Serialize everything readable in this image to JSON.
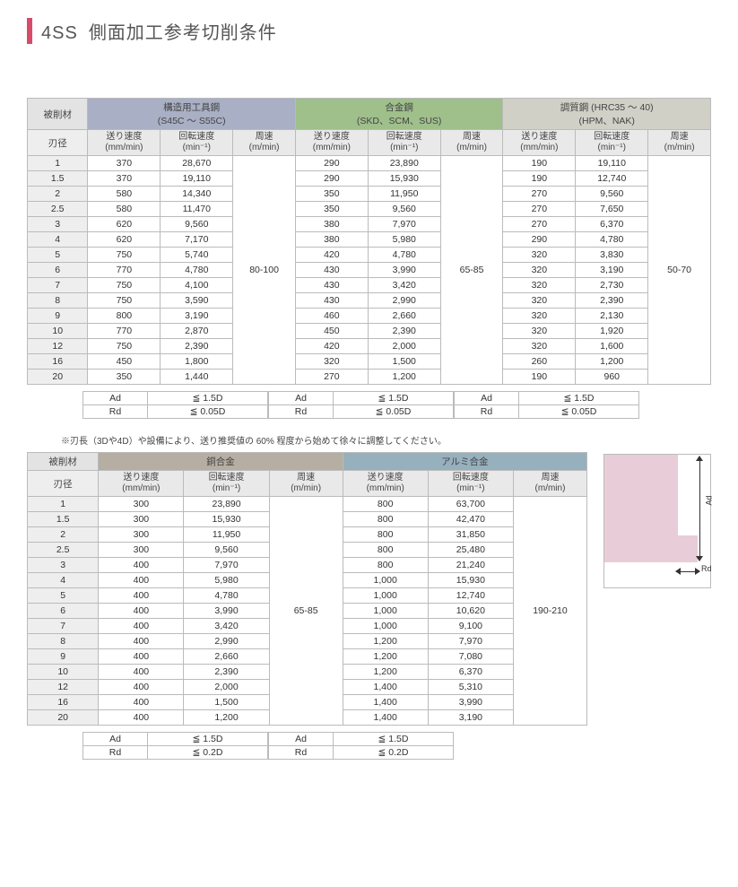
{
  "title_code": "4SS",
  "title_text": "側面加工参考切削条件",
  "labels": {
    "workpiece": "被削材",
    "diameter": "刃径",
    "feed": "送り速度",
    "feed_unit": "(mm/min)",
    "rpm": "回転速度",
    "rpm_unit": "(min⁻¹)",
    "surface": "周速",
    "surface_unit": "(m/min)",
    "ad": "Ad",
    "rd": "Rd"
  },
  "note": "※刃長（3Dや4D）や設備により、送り推奨値の 60% 程度から始めて徐々に調整してください。",
  "materials_top": [
    {
      "name_line1": "構造用工具鋼",
      "name_line2": "(S45C ～ S55C)",
      "cls": "hdr-m0"
    },
    {
      "name_line1": "合金鋼",
      "name_line2": "(SKD、SCM、SUS)",
      "cls": "hdr-m1"
    },
    {
      "name_line1": "調質鋼 (HRC35 ～ 40)",
      "name_line2": "(HPM、NAK)",
      "cls": "hdr-m2"
    }
  ],
  "materials_bottom": [
    {
      "name_line1": "銅合金",
      "name_line2": "",
      "cls": "hdr-m3"
    },
    {
      "name_line1": "アルミ合金",
      "name_line2": "",
      "cls": "hdr-m4"
    }
  ],
  "diameters": [
    "1",
    "1.5",
    "2",
    "2.5",
    "3",
    "4",
    "5",
    "6",
    "7",
    "8",
    "9",
    "10",
    "12",
    "16",
    "20"
  ],
  "top_data": {
    "m0": {
      "surface": "80-100",
      "feed": [
        "370",
        "370",
        "580",
        "580",
        "620",
        "620",
        "750",
        "770",
        "750",
        "750",
        "800",
        "770",
        "750",
        "450",
        "350"
      ],
      "rpm": [
        "28,670",
        "19,110",
        "14,340",
        "11,470",
        "9,560",
        "7,170",
        "5,740",
        "4,780",
        "4,100",
        "3,590",
        "3,190",
        "2,870",
        "2,390",
        "1,800",
        "1,440"
      ],
      "ad": "≦ 1.5D",
      "rd": "≦ 0.05D"
    },
    "m1": {
      "surface": "65-85",
      "feed": [
        "290",
        "290",
        "350",
        "350",
        "380",
        "380",
        "420",
        "430",
        "430",
        "430",
        "460",
        "450",
        "420",
        "320",
        "270"
      ],
      "rpm": [
        "23,890",
        "15,930",
        "11,950",
        "9,560",
        "7,970",
        "5,980",
        "4,780",
        "3,990",
        "3,420",
        "2,990",
        "2,660",
        "2,390",
        "2,000",
        "1,500",
        "1,200"
      ],
      "ad": "≦ 1.5D",
      "rd": "≦ 0.05D"
    },
    "m2": {
      "surface": "50-70",
      "feed": [
        "190",
        "190",
        "270",
        "270",
        "270",
        "290",
        "320",
        "320",
        "320",
        "320",
        "320",
        "320",
        "320",
        "260",
        "190"
      ],
      "rpm": [
        "19,110",
        "12,740",
        "9,560",
        "7,650",
        "6,370",
        "4,780",
        "3,830",
        "3,190",
        "2,730",
        "2,390",
        "2,130",
        "1,920",
        "1,600",
        "1,200",
        "960"
      ],
      "ad": "≦ 1.5D",
      "rd": "≦ 0.05D"
    }
  },
  "bottom_data": {
    "m0": {
      "surface": "65-85",
      "feed": [
        "300",
        "300",
        "300",
        "300",
        "400",
        "400",
        "400",
        "400",
        "400",
        "400",
        "400",
        "400",
        "400",
        "400",
        "400"
      ],
      "rpm": [
        "23,890",
        "15,930",
        "11,950",
        "9,560",
        "7,970",
        "5,980",
        "4,780",
        "3,990",
        "3,420",
        "2,990",
        "2,660",
        "2,390",
        "2,000",
        "1,500",
        "1,200"
      ],
      "ad": "≦ 1.5D",
      "rd": "≦ 0.2D"
    },
    "m1": {
      "surface": "190-210",
      "feed": [
        "800",
        "800",
        "800",
        "800",
        "800",
        "1,000",
        "1,000",
        "1,000",
        "1,000",
        "1,200",
        "1,200",
        "1,200",
        "1,400",
        "1,400",
        "1,400"
      ],
      "rpm": [
        "63,700",
        "42,470",
        "31,850",
        "25,480",
        "21,240",
        "15,930",
        "12,740",
        "10,620",
        "9,100",
        "7,970",
        "7,080",
        "6,370",
        "5,310",
        "3,990",
        "3,190"
      ],
      "ad": "≦ 1.5D",
      "rd": "≦ 0.2D"
    }
  },
  "diagram": {
    "ad": "Ad",
    "rd": "Rd"
  }
}
